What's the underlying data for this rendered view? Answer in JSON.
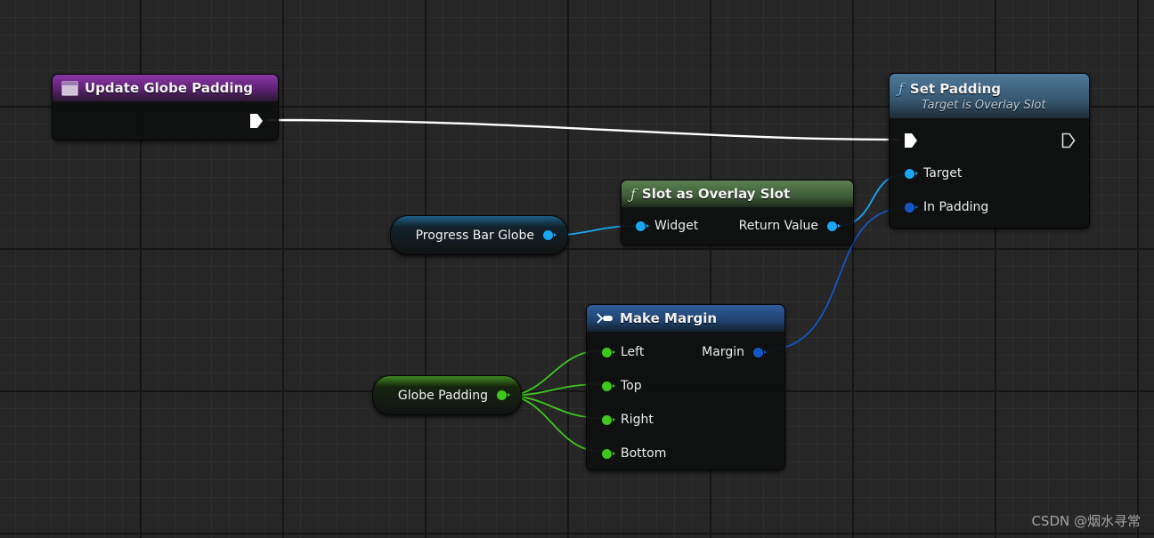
{
  "nodes": {
    "event": {
      "title": "Update Globe Padding",
      "color": "#7a2a93"
    },
    "set_padding": {
      "title": "Set Padding",
      "subtitle": "Target is Overlay Slot",
      "target_label": "Target",
      "in_padding_label": "In Padding",
      "color": "#3d6482"
    },
    "slot_as": {
      "title": "Slot as Overlay Slot",
      "widget_label": "Widget",
      "return_label": "Return Value",
      "color": "#4a6d44"
    },
    "make_margin": {
      "title": "Make Margin",
      "left_label": "Left",
      "top_label": "Top",
      "right_label": "Right",
      "bottom_label": "Bottom",
      "margin_label": "Margin",
      "color": "#234b85"
    }
  },
  "variables": {
    "progress_bar": "Progress Bar Globe",
    "globe_padding": "Globe Padding"
  },
  "icons": {
    "event": "event-node-icon",
    "function": "function-icon",
    "make": "make-struct-icon"
  },
  "pin_colors": {
    "exec": "#ffffff",
    "object": "#19a7f2",
    "struct": "#1357c7",
    "float": "#3ec81e"
  },
  "watermark": "CSDN @烟水寻常"
}
